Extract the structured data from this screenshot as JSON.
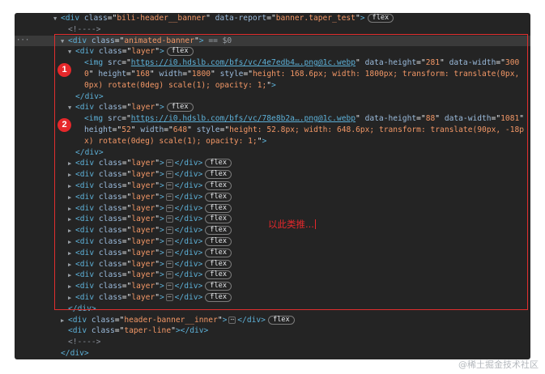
{
  "elements": {
    "div": "div",
    "img": "img",
    "class_attr": "class",
    "src_attr": "src",
    "data_report_attr": "data-report",
    "data_height_attr": "data-height",
    "data_width_attr": "data-width",
    "height_attr": "height",
    "width_attr": "width",
    "style_attr": "style",
    "header_banner_class": "bili-header__banner",
    "data_report_value": "banner.taper_test",
    "animated_banner_class": "animated-banner",
    "layer_class": "layer",
    "header_banner_inner_class": "header-banner__inner",
    "taper_line_class": "taper-line",
    "flex_badge": "flex",
    "selected_suffix": "== $0",
    "comment": "<!---->",
    "ellipsis": "⋯"
  },
  "img1": {
    "src": "https://i0.hdslb.com/bfs/vc/4e7edb4….png@1c.webp",
    "data_height": "281",
    "data_width": "3000",
    "height": "168",
    "width": "1800",
    "style": "height: 168.6px; width: 1800px; transform: translate(0px, 0px) rotate(0deg) scale(1); opacity: 1;"
  },
  "img2": {
    "src": "https://i0.hdslb.com/bfs/vc/78e8b2a….png@1c.webp",
    "data_height": "88",
    "data_width": "1081",
    "height": "52",
    "width": "648",
    "style": "height: 52.8px; width: 648.6px; transform: translate(90px, -18px) rotate(0deg) scale(1); opacity: 1;"
  },
  "collapsed_layers_count": 13,
  "markers": {
    "one": "1",
    "two": "2"
  },
  "annotation": "以此类推...",
  "watermark": "@稀土掘金技术社区",
  "colors": {
    "panel_bg": "#242424",
    "tag": "#5db0d7",
    "attr": "#9bbbdc",
    "value": "#f29766",
    "annotation_red": "#e6282b"
  }
}
